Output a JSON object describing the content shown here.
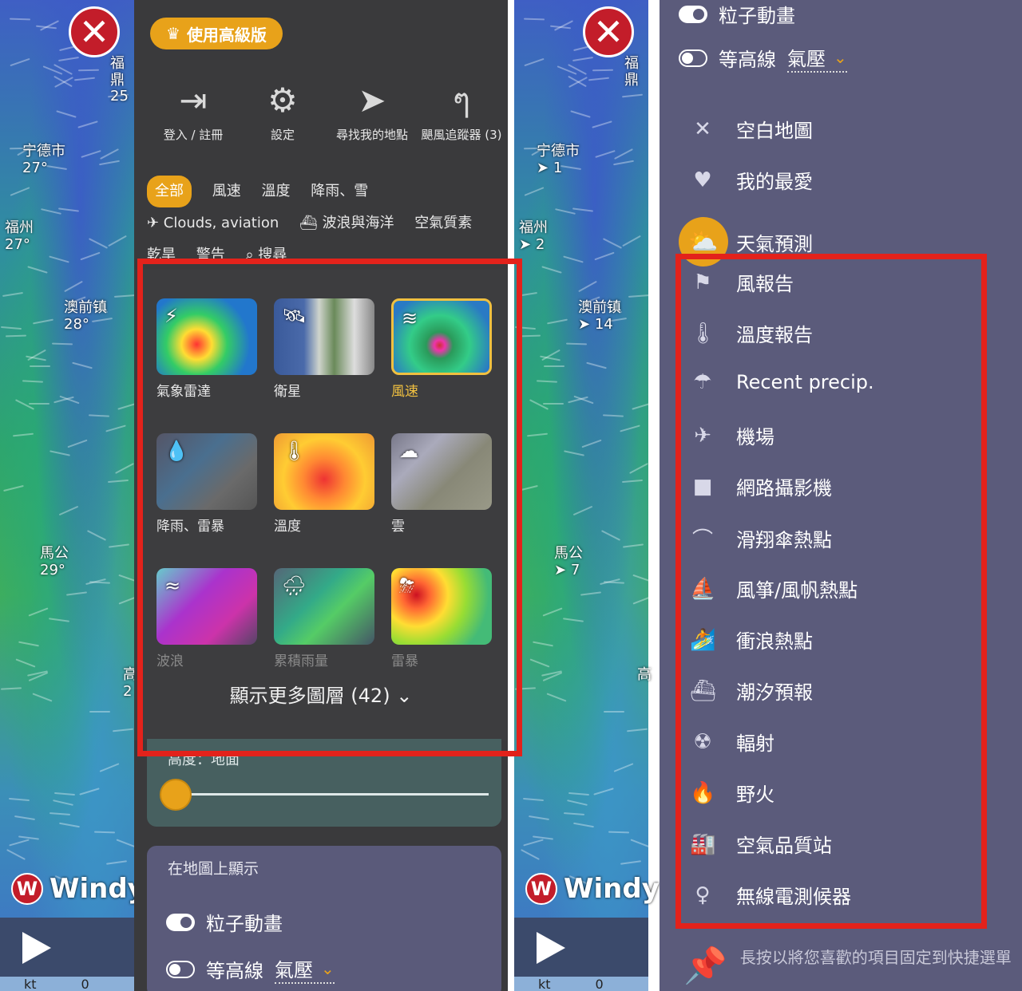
{
  "left": {
    "close_label": "✕",
    "cities": [
      {
        "name": "福鼎",
        "value": "25"
      },
      {
        "name": "宁德市",
        "value": "27°"
      },
      {
        "name": "福州",
        "value": "27°"
      },
      {
        "name": "澳前镇",
        "value": "28°"
      },
      {
        "name": "馬公",
        "value": "29°"
      },
      {
        "name": "高",
        "value": "2"
      }
    ],
    "windy_logo": "Windy",
    "scale_unit": "kt",
    "scale_value": "0",
    "premium_button": "使用高級版",
    "top_icons": [
      {
        "icon": "login-icon",
        "label": "登入 / 註冊"
      },
      {
        "icon": "gear-icon",
        "label": "設定"
      },
      {
        "icon": "location-arrow-icon",
        "label": "尋找我的地點"
      },
      {
        "icon": "hurricane-icon",
        "label": "颶風追蹤器 (3)"
      }
    ],
    "tabs_row1": [
      "全部",
      "風速",
      "溫度",
      "降雨、雪"
    ],
    "tabs_row2": [
      "✈ Clouds, aviation",
      "波浪與海洋",
      "空氣質素"
    ],
    "tabs_row3": [
      "乾旱",
      "警告",
      "搜尋"
    ],
    "layers": [
      {
        "label": "氣象雷達",
        "icon": "storm-icon",
        "state": "normal"
      },
      {
        "label": "衛星",
        "icon": "satellite-icon",
        "state": "normal"
      },
      {
        "label": "風速",
        "icon": "wind-icon",
        "state": "active"
      },
      {
        "label": "降雨、雷暴",
        "icon": "raindrop-icon",
        "state": "normal"
      },
      {
        "label": "溫度",
        "icon": "thermometer-icon",
        "state": "normal"
      },
      {
        "label": "雲",
        "icon": "cloud-icon",
        "state": "normal"
      },
      {
        "label": "波浪",
        "icon": "waves-icon",
        "state": "dim"
      },
      {
        "label": "累積雨量",
        "icon": "rain-cloud-icon",
        "state": "dim"
      },
      {
        "label": "雷暴",
        "icon": "thunderstorm-icon",
        "state": "dim"
      }
    ],
    "more_layers": "顯示更多圖層 (42)",
    "height_label": "高度：地面",
    "show_on_map_title": "在地圖上顯示",
    "particles_label": "粒子動畫",
    "contours_label": "等高線",
    "contours_value": "氣壓"
  },
  "right": {
    "cities": [
      {
        "name": "福鼎",
        "value": ""
      },
      {
        "name": "宁德市",
        "value": "1"
      },
      {
        "name": "福州",
        "value": "2"
      },
      {
        "name": "澳前镇",
        "value": "14"
      },
      {
        "name": "馬公",
        "value": "7"
      },
      {
        "name": "高",
        "value": ""
      }
    ],
    "particles_label": "粒子動畫",
    "contours_label": "等高線",
    "contours_value": "氣壓",
    "menu_items": [
      {
        "label": "空白地圖",
        "icon": "close-icon"
      },
      {
        "label": "我的最愛",
        "icon": "heart-icon"
      },
      {
        "label": "天氣預測",
        "icon": "sun-cloud-icon"
      },
      {
        "label": "風報告",
        "icon": "windsock-icon"
      },
      {
        "label": "溫度報告",
        "icon": "thermometer-icon"
      },
      {
        "label": "Recent precip.",
        "icon": "umbrella-icon"
      },
      {
        "label": "機場",
        "icon": "airplane-icon"
      },
      {
        "label": "網路攝影機",
        "icon": "camera-icon"
      },
      {
        "label": "滑翔傘熱點",
        "icon": "paraglider-icon"
      },
      {
        "label": "風箏/風帆熱點",
        "icon": "kitesurf-icon"
      },
      {
        "label": "衝浪熱點",
        "icon": "surfer-icon"
      },
      {
        "label": "潮汐預報",
        "icon": "ship-icon"
      },
      {
        "label": "輻射",
        "icon": "radiation-icon"
      },
      {
        "label": "野火",
        "icon": "fire-icon"
      },
      {
        "label": "空氣品質站",
        "icon": "factory-icon"
      },
      {
        "label": "無線電測候器",
        "icon": "balloon-icon"
      }
    ],
    "pin_hint": "長按以將您喜歡的項目固定到快捷選單"
  },
  "colors": {
    "accent": "#e8a21a",
    "highlight": "#e3221b",
    "menu_dark": "#3a3a3c",
    "menu_purple": "#5b5b7b",
    "close_red": "#c31d2a"
  }
}
